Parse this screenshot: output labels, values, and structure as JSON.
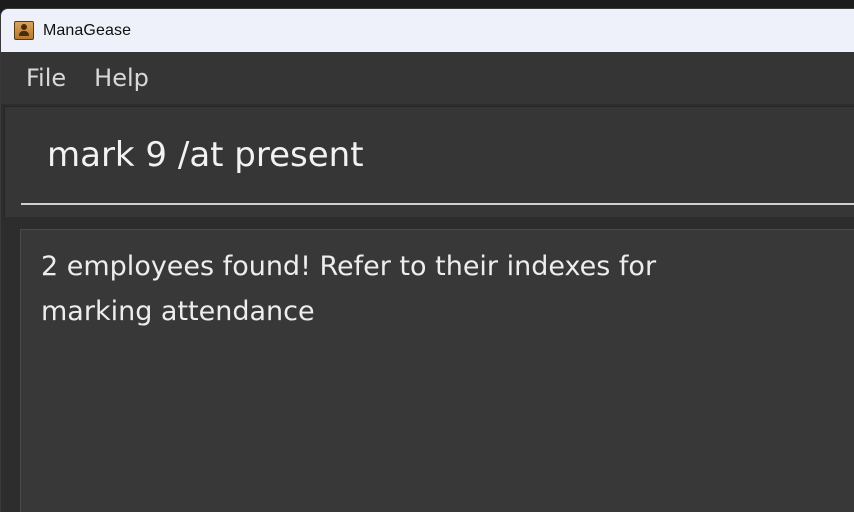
{
  "window": {
    "title": "ManaGease",
    "icon": "address-book-icon"
  },
  "menubar": {
    "items": [
      {
        "label": "File"
      },
      {
        "label": "Help"
      }
    ]
  },
  "command": {
    "value": "mark 9 /at present"
  },
  "result": {
    "message": "2 employees found! Refer to their indexes for marking attendance"
  }
}
